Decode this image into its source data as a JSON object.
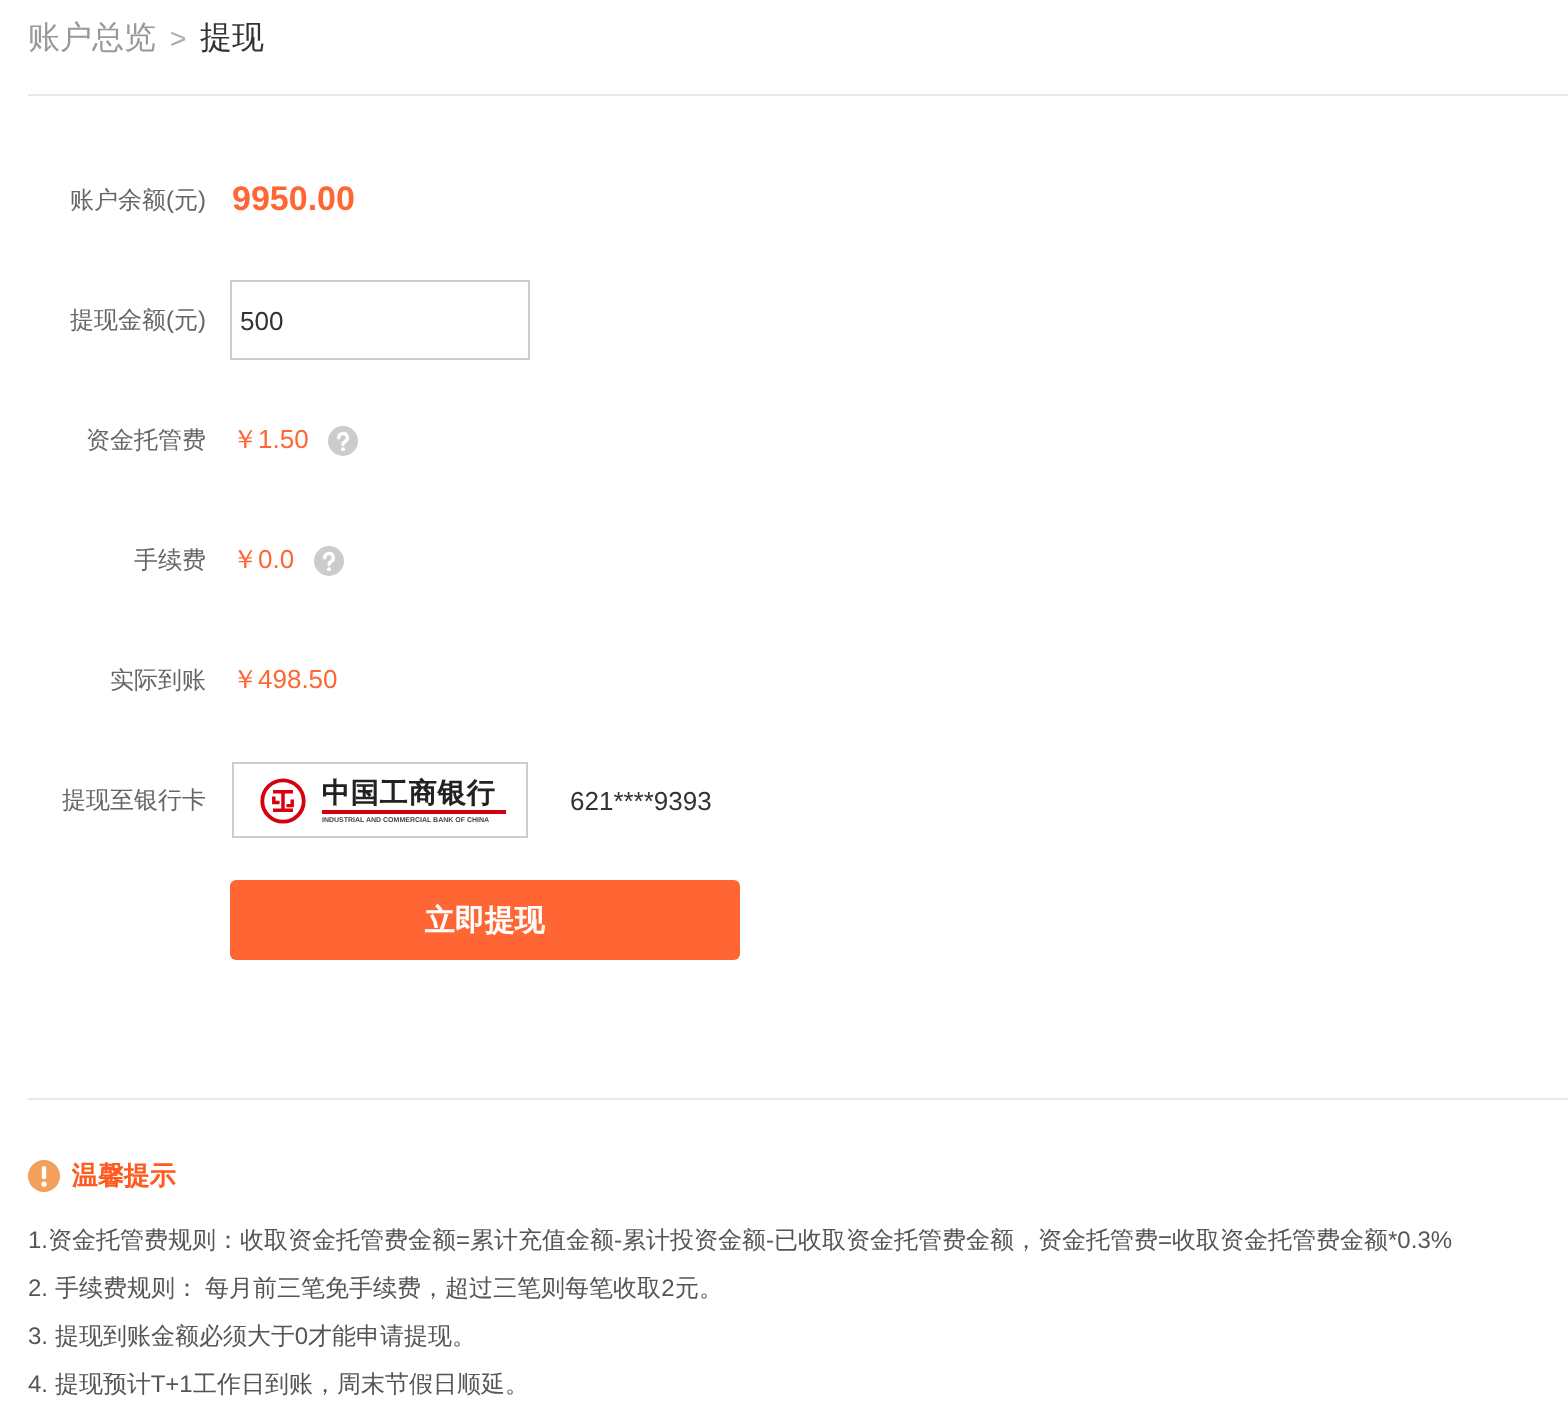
{
  "breadcrumb": {
    "separator": ">",
    "items": [
      {
        "label": "账户总览",
        "current": false
      },
      {
        "label": "提现",
        "current": true
      }
    ]
  },
  "form": {
    "rows": [
      {
        "kind": "amount",
        "label": "账户余额(元)",
        "value": "9950.00"
      },
      {
        "kind": "input",
        "label": "提现金额(元)",
        "value": "500"
      },
      {
        "kind": "fee",
        "label": "资金托管费",
        "value": "￥1.50",
        "help": true
      },
      {
        "kind": "fee",
        "label": "手续费",
        "value": "￥0.0",
        "help": true
      },
      {
        "kind": "fee",
        "label": "实际到账",
        "value": "￥498.50",
        "help": false
      },
      {
        "kind": "bank",
        "label": "提现至银行卡",
        "bank_name": "中国工商银行",
        "bank_subtitle": "INDUSTRIAL AND COMMERCIAL BANK OF CHINA",
        "card_number": "621****9393"
      }
    ],
    "submit_button": "立即提现"
  },
  "tips": {
    "title": "温馨提示",
    "items": [
      "1.资金托管费规则：收取资金托管费金额=累计充值金额-累计投资金额-已收取资金托管费金额，资金托管费=收取资金托管费金额*0.3%",
      "2. 手续费规则： 每月前三笔免手续费，超过三笔则每笔收取2元。",
      "3. 提现到账金额必须大于0才能申请提现。",
      "4. 提现预计T+1工作日到账，周末节假日顺延。"
    ]
  }
}
